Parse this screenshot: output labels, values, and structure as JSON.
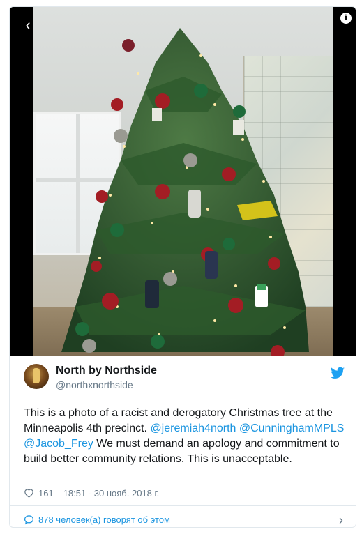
{
  "media": {
    "back_glyph": "‹",
    "info_glyph": "i"
  },
  "author": {
    "name": "North by Northside",
    "handle": "@northxnorthside"
  },
  "tweet": {
    "text_1": "This is a photo of a racist and derogatory Christmas tree at the Minneapolis 4th precinct. ",
    "mention_1": "@jeremiah4north",
    "space_1": " ",
    "mention_2": "@CunninghamMPLS",
    "space_2": " ",
    "mention_3": "@Jacob_Frey",
    "text_2": " We must demand an apology and commitment to build better community relations. This is unacceptable."
  },
  "meta": {
    "likes": "161",
    "timestamp": "18:51 - 30 нояб. 2018 г."
  },
  "footer": {
    "talk_label": "878 человек(а) говорят об этом",
    "chevron": "›"
  },
  "colors": {
    "link": "#1b95e0",
    "muted": "#657786",
    "twitter_blue": "#1da1f2"
  },
  "icons": [
    "back-arrow-icon",
    "info-icon",
    "twitter-bird-icon",
    "heart-icon",
    "speech-bubble-icon",
    "chevron-right-icon"
  ]
}
